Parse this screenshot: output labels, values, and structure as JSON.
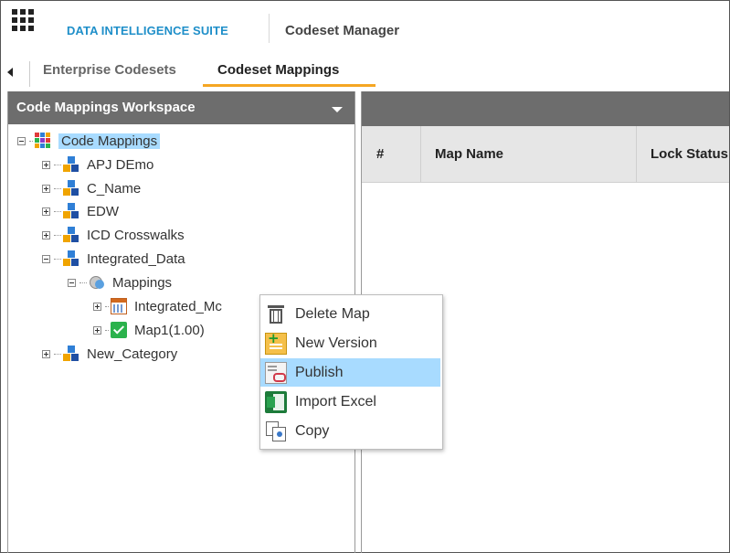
{
  "header": {
    "brand": "DATA INTELLIGENCE SUITE",
    "app_title": "Codeset Manager",
    "menu_icon": "grid-menu-icon"
  },
  "tabs": [
    {
      "label": "Enterprise Codesets",
      "active": false
    },
    {
      "label": "Codeset Mappings",
      "active": true
    }
  ],
  "workspace": {
    "title": "Code Mappings Workspace",
    "tree": {
      "root": "Code Mappings",
      "categories": [
        "APJ DEmo",
        "C_Name",
        "EDW",
        "ICD Crosswalks",
        "Integrated_Data"
      ],
      "mappings_folder": "Mappings",
      "mapping_items": [
        "Integrated_Mc",
        "Map1(1.00)"
      ],
      "last_category": "New_Category"
    }
  },
  "table": {
    "columns": [
      "#",
      "Map Name",
      "Lock Status"
    ]
  },
  "context_menu": {
    "items": [
      {
        "label": "Delete Map",
        "icon": "trash-icon"
      },
      {
        "label": "New Version",
        "icon": "new-version-icon"
      },
      {
        "label": "Publish",
        "icon": "publish-icon",
        "highlighted": true
      },
      {
        "label": "Import Excel",
        "icon": "excel-icon"
      },
      {
        "label": "Copy",
        "icon": "copy-icon"
      }
    ]
  },
  "colors": {
    "brand": "#1f8fc9",
    "tab_underline": "#f5a623",
    "panel_header": "#6d6d6d",
    "selection": "#a8dbff"
  }
}
